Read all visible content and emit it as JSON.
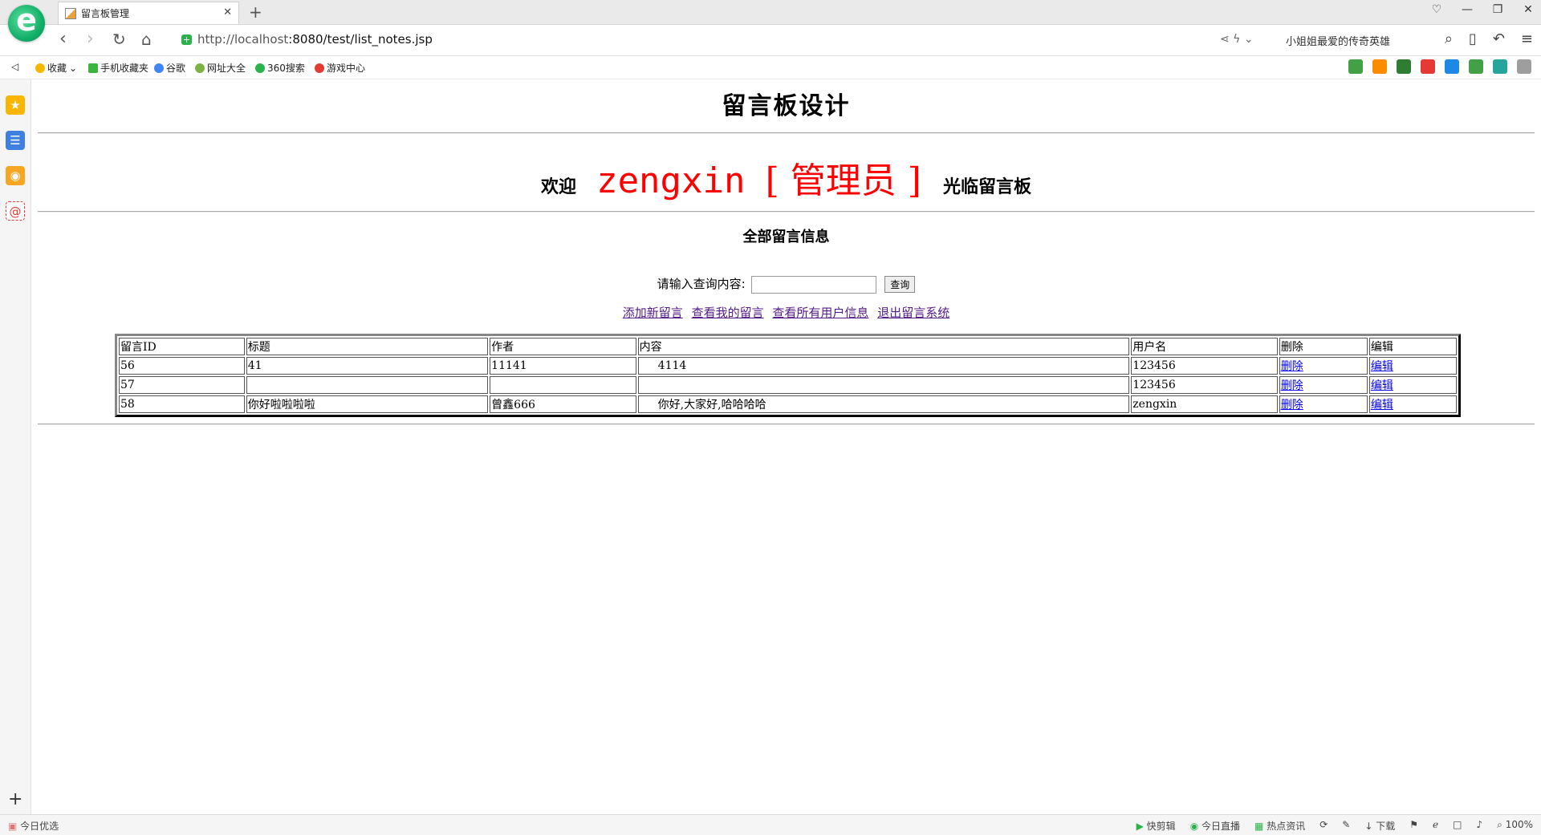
{
  "browser": {
    "tab_title": "留言板管理",
    "url_host": "http://localhost",
    "url_rest": ":8080/test/list_notes.jsp",
    "search_hint": "小姐姐最爱的传奇英雄",
    "bookmarks": [
      "收藏",
      "手机收藏夹",
      "谷歌",
      "网址大全",
      "360搜索",
      "游戏中心"
    ],
    "status_left": "今日优选",
    "status_items": [
      "快剪辑",
      "今日直播",
      "热点资讯",
      "下载",
      "100%"
    ]
  },
  "page": {
    "title": "留言板设计",
    "welcome_prefix": "欢迎",
    "username": "zengxin",
    "role": "[ 管理员 ]",
    "welcome_suffix": "光临留言板",
    "section_title": "全部留言信息",
    "search_label": "请输入查询内容:",
    "search_value": "",
    "search_button": "查询",
    "links": {
      "add": "添加新留言",
      "mine": "查看我的留言",
      "users": "查看所有用户信息",
      "logout": "退出留言系统"
    },
    "table": {
      "headers": [
        "留言ID",
        "标题",
        "作者",
        "内容",
        "用户名",
        "删除",
        "编辑"
      ],
      "rows": [
        {
          "id": "56",
          "title": "41",
          "author": "11141",
          "content": "4114",
          "user": "123456",
          "delete": "删除",
          "edit": "编辑"
        },
        {
          "id": "57",
          "title": "",
          "author": "",
          "content": "",
          "user": "123456",
          "delete": "删除",
          "edit": "编辑"
        },
        {
          "id": "58",
          "title": "你好啦啦啦啦",
          "author": "曾鑫666",
          "content": "你好,大家好,哈哈哈哈",
          "user": "zengxin",
          "delete": "删除",
          "edit": "编辑"
        }
      ]
    }
  }
}
